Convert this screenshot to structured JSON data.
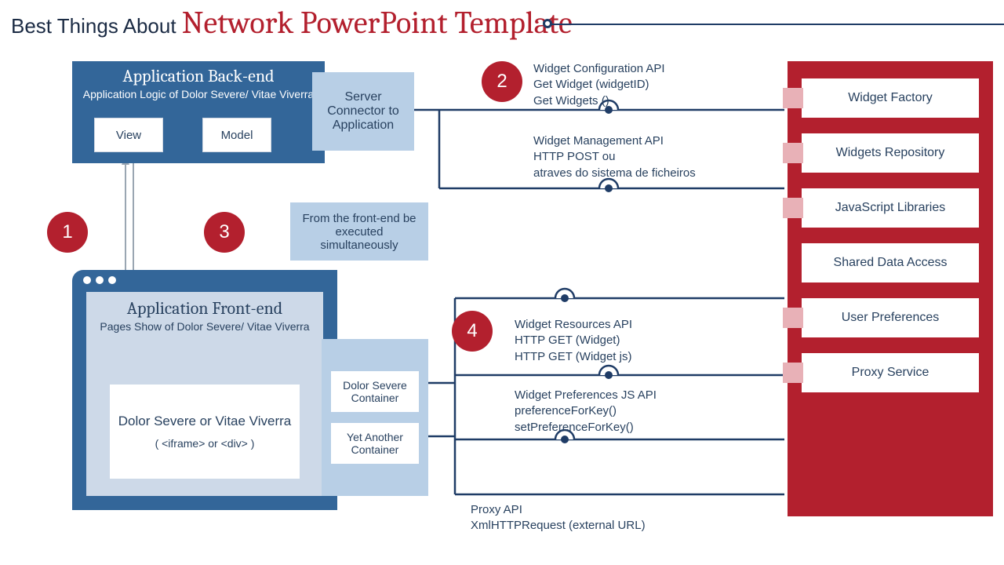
{
  "title": {
    "prefix": "Best Things About ",
    "accent": "Network PowerPoint Template"
  },
  "badges": {
    "n1": "1",
    "n2": "2",
    "n3": "3",
    "n4": "4"
  },
  "backend": {
    "heading": "Application Back-end",
    "sub": "Application Logic of Dolor Severe/ Vitae Viverra",
    "view": "View",
    "model": "Model"
  },
  "server_connector": "Server Connector to Application",
  "exec_note": "From the front-end be executed simultaneously",
  "frontend": {
    "heading": "Application Front-end",
    "sub": "Pages Show of Dolor Severe/ Vitae Viverra",
    "content_main": "Dolor Severe or Vitae Viverra",
    "content_sub": "( <iframe> or <div> )"
  },
  "containers": {
    "c1": "Dolor Severe Container",
    "c2": "Yet Another Container"
  },
  "apis": {
    "a1_l1": "Widget Configuration API",
    "a1_l2": "Get Widget (widgetID)",
    "a1_l3": "Get Widgets ()",
    "a2_l1": "Widget Management API",
    "a2_l2": "HTTP POST ou",
    "a2_l3": "atraves do sistema de ficheiros",
    "a3_l1": "Widget Resources API",
    "a3_l2": "HTTP GET (Widget)",
    "a3_l3": "HTTP GET (Widget js)",
    "a4_l1": "Widget Preferences JS API",
    "a4_l2": "preferenceForKey()",
    "a4_l3": "setPreferenceForKey()",
    "a5_l1": "Proxy API",
    "a5_l2": "XmlHTTPRequest (external URL)"
  },
  "right_items": {
    "r1": "Widget Factory",
    "r2": "Widgets Repository",
    "r3": "JavaScript Libraries",
    "r4": "Shared Data Access",
    "r5": "User Preferences",
    "r6": "Proxy Service"
  }
}
